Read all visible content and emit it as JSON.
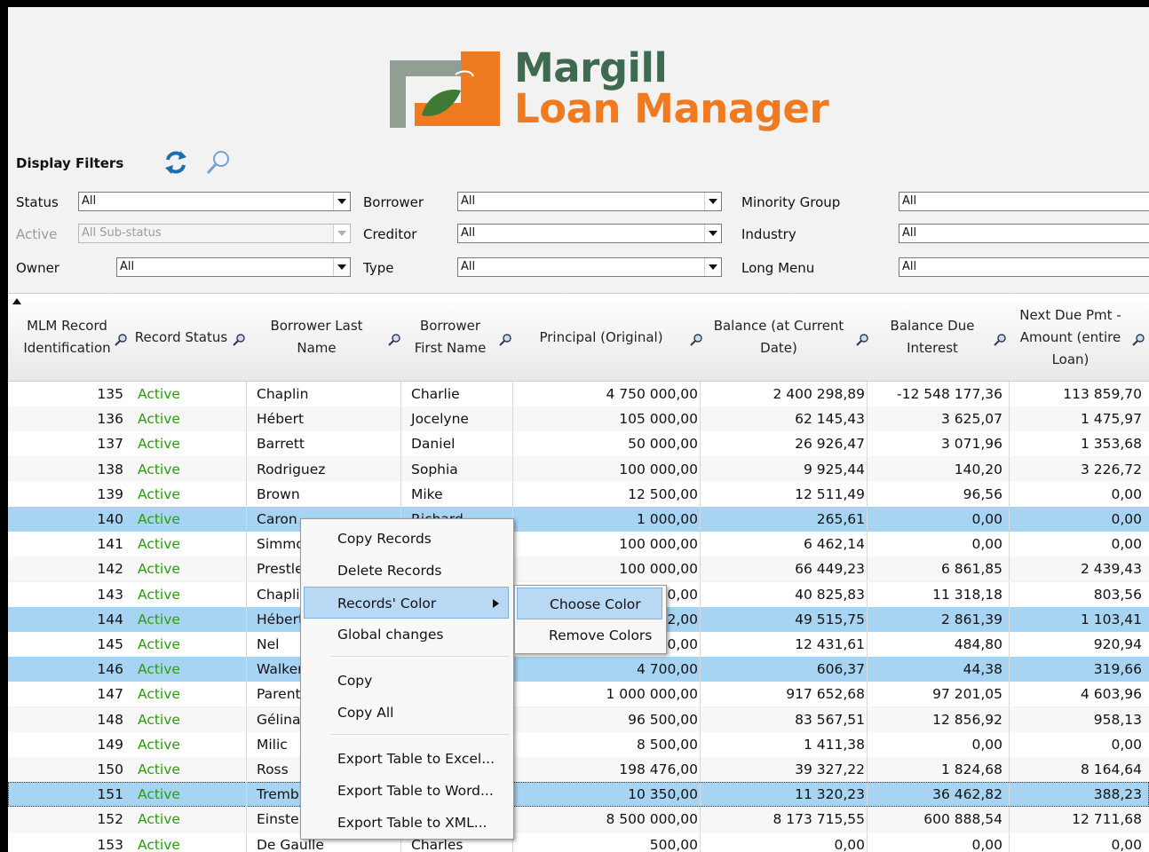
{
  "app": {
    "logo_line1": "Margill",
    "logo_line2": "Loan Manager",
    "colors": {
      "brand_green": "#3e6b4f",
      "brand_orange": "#f07a20",
      "status_green": "#2a9d0a",
      "row_highlight": "#a8d4f4"
    }
  },
  "filters": {
    "title": "Display Filters",
    "refresh_icon": "refresh-icon",
    "search_icon": "search-icon",
    "status": {
      "label": "Status",
      "value": "All"
    },
    "substatus": {
      "label": "Active",
      "value": "All Sub-status"
    },
    "owner": {
      "label": "Owner",
      "value": "All"
    },
    "borrower": {
      "label": "Borrower",
      "value": "All"
    },
    "creditor": {
      "label": "Creditor",
      "value": "All"
    },
    "type": {
      "label": "Type",
      "value": "All"
    },
    "minority": {
      "label": "Minority Group",
      "value": "All"
    },
    "industry": {
      "label": "Industry",
      "value": "All"
    },
    "longmenu": {
      "label": "Long Menu",
      "value": "All"
    }
  },
  "table": {
    "headers": {
      "id": "MLM Record Identification",
      "status": "Record Status",
      "last": "Borrower Last Name",
      "first": "Borrower First Name",
      "principal": "Principal (Original)",
      "balance": "Balance (at Current Date)",
      "interest": "Balance Due Interest",
      "nextpmt": "Next Due Pmt - Amount (entire Loan)"
    },
    "rows": [
      {
        "id": "135",
        "status": "Active",
        "last": "Chaplin",
        "first": "Charlie",
        "principal": "4 750 000,00",
        "balance": "2 400 298,89",
        "interest": "-12 548 177,36",
        "nextpmt": "113 859,70"
      },
      {
        "id": "136",
        "status": "Active",
        "last": "Hébert",
        "first": "Jocelyne",
        "principal": "105 000,00",
        "balance": "62 145,43",
        "interest": "3 625,07",
        "nextpmt": "1 475,97"
      },
      {
        "id": "137",
        "status": "Active",
        "last": "Barrett",
        "first": "Daniel",
        "principal": "50 000,00",
        "balance": "26 926,47",
        "interest": "3 071,96",
        "nextpmt": "1 353,68"
      },
      {
        "id": "138",
        "status": "Active",
        "last": "Rodriguez",
        "first": "Sophia",
        "principal": "100 000,00",
        "balance": "9 925,44",
        "interest": "140,20",
        "nextpmt": "3 226,72"
      },
      {
        "id": "139",
        "status": "Active",
        "last": "Brown",
        "first": "Mike",
        "principal": "12 500,00",
        "balance": "12 511,49",
        "interest": "96,56",
        "nextpmt": "0,00"
      },
      {
        "id": "140",
        "status": "Active",
        "last": "Caron",
        "first": "Richard",
        "principal": "1 000,00",
        "balance": "265,61",
        "interest": "0,00",
        "nextpmt": "0,00"
      },
      {
        "id": "141",
        "status": "Active",
        "last": "Simmons",
        "first": "",
        "principal": "100 000,00",
        "balance": "6 462,14",
        "interest": "0,00",
        "nextpmt": "0,00"
      },
      {
        "id": "142",
        "status": "Active",
        "last": "Prestley",
        "first": "",
        "principal": "100 000,00",
        "balance": "66 449,23",
        "interest": "6 861,85",
        "nextpmt": "2 439,43"
      },
      {
        "id": "143",
        "status": "Active",
        "last": "Chaplin",
        "first": "",
        "principal": "0,00",
        "balance": "40 825,83",
        "interest": "11 318,18",
        "nextpmt": "803,56"
      },
      {
        "id": "144",
        "status": "Active",
        "last": "Hébert",
        "first": "",
        "principal": "2,00",
        "balance": "49 515,75",
        "interest": "2 861,39",
        "nextpmt": "1 103,41"
      },
      {
        "id": "145",
        "status": "Active",
        "last": "Nel",
        "first": "",
        "principal": "0,00",
        "balance": "12 431,61",
        "interest": "484,80",
        "nextpmt": "920,94"
      },
      {
        "id": "146",
        "status": "Active",
        "last": "Walker",
        "first": "",
        "principal": "4 700,00",
        "balance": "606,37",
        "interest": "44,38",
        "nextpmt": "319,66"
      },
      {
        "id": "147",
        "status": "Active",
        "last": "Parent",
        "first": "",
        "principal": "1 000 000,00",
        "balance": "917 652,68",
        "interest": "97 201,05",
        "nextpmt": "4 603,96"
      },
      {
        "id": "148",
        "status": "Active",
        "last": "Gélinas",
        "first": "",
        "principal": "96 500,00",
        "balance": "83 567,51",
        "interest": "12 856,92",
        "nextpmt": "958,13"
      },
      {
        "id": "149",
        "status": "Active",
        "last": "Milic",
        "first": "",
        "principal": "8 500,00",
        "balance": "1 411,38",
        "interest": "0,00",
        "nextpmt": "0,00"
      },
      {
        "id": "150",
        "status": "Active",
        "last": "Ross",
        "first": "",
        "principal": "198 476,00",
        "balance": "39 327,22",
        "interest": "1 824,68",
        "nextpmt": "8 164,64"
      },
      {
        "id": "151",
        "status": "Active",
        "last": "Tremblay",
        "first": "",
        "principal": "10 350,00",
        "balance": "11 320,23",
        "interest": "36 462,82",
        "nextpmt": "388,23"
      },
      {
        "id": "152",
        "status": "Active",
        "last": "Einstein",
        "first": "",
        "principal": "8 500 000,00",
        "balance": "8 173 715,55",
        "interest": "600 888,54",
        "nextpmt": "12 711,68"
      },
      {
        "id": "153",
        "status": "Active",
        "last": "De Gaulle",
        "first": "Charles",
        "principal": "500,00",
        "balance": "0,00",
        "interest": "0,00",
        "nextpmt": "0,00"
      }
    ]
  },
  "context_menu": {
    "items": [
      "Copy Records",
      "Delete Records",
      "Records' Color",
      "Global changes",
      "Copy",
      "Copy All",
      "Export Table to Excel...",
      "Export Table to Word...",
      "Export Table to XML..."
    ],
    "submenu": [
      "Choose Color",
      "Remove Colors"
    ]
  }
}
